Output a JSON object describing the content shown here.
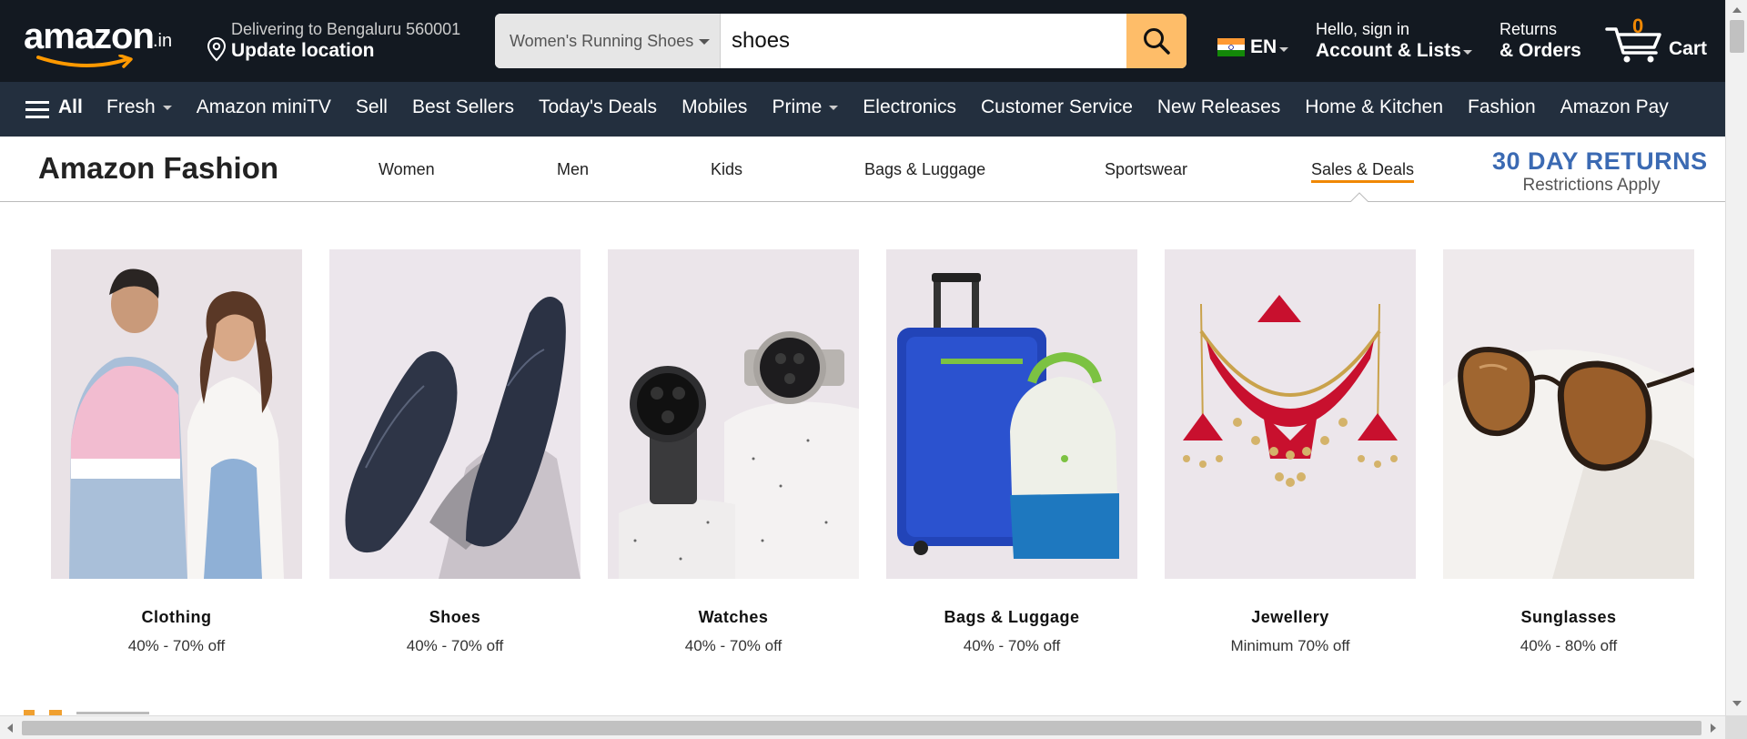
{
  "header": {
    "logo_text": "amazon",
    "logo_suffix": ".in",
    "deliver_line1": "Delivering to Bengaluru 560001",
    "deliver_line2": "Update location",
    "search_category": "Women's Running Shoes",
    "search_value": "shoes",
    "language": "EN",
    "account_line1": "Hello, sign in",
    "account_line2": "Account & Lists",
    "orders_line1": "Returns",
    "orders_line2": "& Orders",
    "cart_count": "0",
    "cart_label": "Cart"
  },
  "icons": {
    "logo": "amazon-smile-logo",
    "location": "location-pin-icon",
    "search": "magnifier-icon",
    "flag": "india-flag-icon",
    "cart": "shopping-cart-icon",
    "menu": "hamburger-icon"
  },
  "nav": {
    "all_label": "All",
    "items": [
      {
        "label": "Fresh",
        "dropdown": true
      },
      {
        "label": "Amazon miniTV",
        "dropdown": false
      },
      {
        "label": "Sell",
        "dropdown": false
      },
      {
        "label": "Best Sellers",
        "dropdown": false
      },
      {
        "label": "Today's Deals",
        "dropdown": false
      },
      {
        "label": "Mobiles",
        "dropdown": false
      },
      {
        "label": "Prime",
        "dropdown": true
      },
      {
        "label": "Electronics",
        "dropdown": false
      },
      {
        "label": "Customer Service",
        "dropdown": false
      },
      {
        "label": "New Releases",
        "dropdown": false
      },
      {
        "label": "Home & Kitchen",
        "dropdown": false
      },
      {
        "label": "Fashion",
        "dropdown": false
      },
      {
        "label": "Amazon Pay",
        "dropdown": false
      }
    ]
  },
  "fashion": {
    "brand": "Amazon Fashion",
    "links": [
      "Women",
      "Men",
      "Kids",
      "Bags & Luggage",
      "Sportswear",
      "Sales & Deals"
    ],
    "active_link": "Sales & Deals",
    "returns_line1": "30 DAY RETURNS",
    "returns_line2": "Restrictions Apply"
  },
  "categories": [
    {
      "name": "Clothing",
      "discount": "40% - 70% off",
      "image": "couple-in-shirts-photo"
    },
    {
      "name": "Shoes",
      "discount": "40% - 70% off",
      "image": "navy-boat-shoes-photo"
    },
    {
      "name": "Watches",
      "discount": "40% - 70% off",
      "image": "wrist-watches-photo"
    },
    {
      "name": "Bags & Luggage",
      "discount": "40% - 70% off",
      "image": "suitcase-and-backpack-photo"
    },
    {
      "name": "Jewellery",
      "discount": "Minimum 70% off",
      "image": "red-gold-necklace-set-photo"
    },
    {
      "name": "Sunglasses",
      "discount": "40% - 80% off",
      "image": "aviator-sunglasses-photo"
    }
  ],
  "colors": {
    "header_bg": "#131921",
    "nav_bg": "#232f3e",
    "search_button": "#febd69",
    "accent_orange": "#f08804",
    "returns_blue": "#3b6ab3",
    "tile_bg": "#efe9ee"
  }
}
